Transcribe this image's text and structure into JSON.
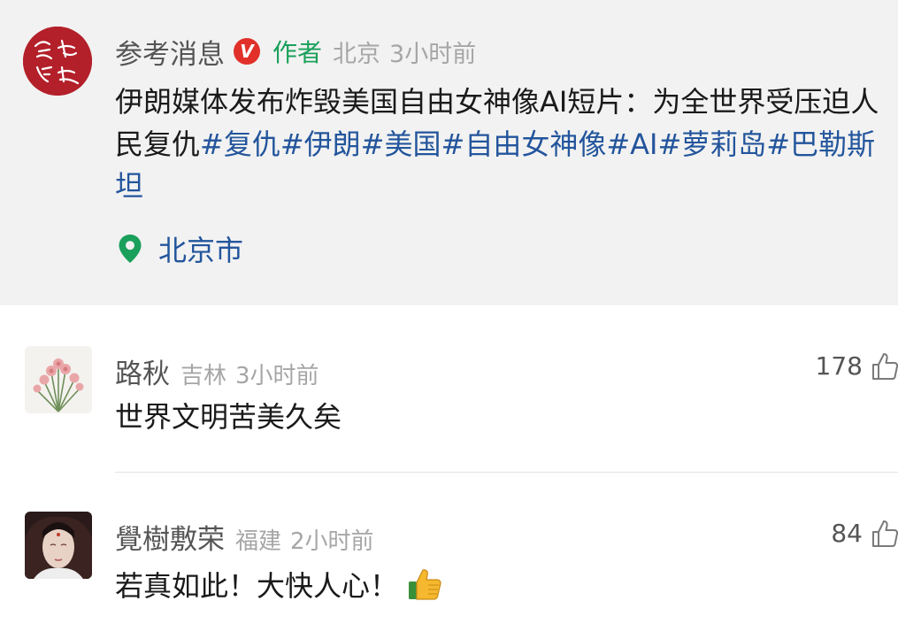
{
  "post": {
    "author": "参考消息",
    "verified_badge": "V",
    "author_tag": "作者",
    "location_meta": "北京",
    "time": "3小时前",
    "avatar_text": "参考消息",
    "text_plain": "伊朗媒体发布炸毁美国自由女神像AI短片：为全世界受压迫人民复仇",
    "hashtags": [
      "#复仇",
      "#伊朗",
      "#美国",
      "#自由女神像",
      "#AI",
      "#萝莉岛",
      "#巴勒斯坦"
    ],
    "place_icon": "location-pin-icon",
    "place": "北京市"
  },
  "comments": [
    {
      "name": "路秋",
      "location": "吉林",
      "time": "3小时前",
      "likes": "178",
      "text": "世界文明苦美久矣",
      "avatar_icon": "carnation-flower-avatar"
    },
    {
      "name": "覺樹敷荣",
      "location": "福建",
      "time": "2小时前",
      "likes": "84",
      "text": "若真如此！大快人心！",
      "emoji": "thumbs-up-emoji",
      "avatar_icon": "portrait-avatar"
    }
  ],
  "colors": {
    "link": "#23559c",
    "author_tag": "#1aa05a",
    "badge": "#e1302a",
    "meta": "#a6a6a6"
  }
}
